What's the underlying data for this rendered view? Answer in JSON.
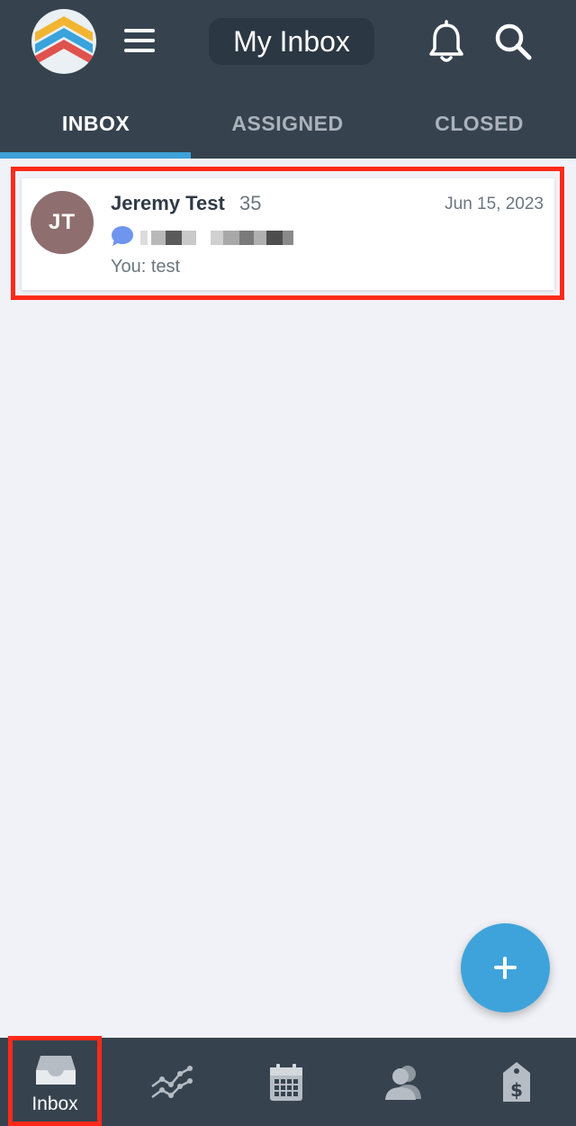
{
  "header": {
    "title": "My Inbox",
    "logo_icon": "striped-chevron-logo",
    "menu_icon": "hamburger-menu-icon",
    "bell_icon": "bell-icon",
    "search_icon": "search-icon"
  },
  "tabs": [
    {
      "label": "INBOX",
      "active": true
    },
    {
      "label": "ASSIGNED",
      "active": false
    },
    {
      "label": "CLOSED",
      "active": false
    }
  ],
  "conversations": [
    {
      "avatar_initials": "JT",
      "name": "Jeremy Test",
      "count": "35",
      "date": "Jun 15, 2023",
      "channel_icon": "chat-bubble-icon",
      "preview": "You: test"
    }
  ],
  "fab": {
    "icon": "plus-icon"
  },
  "bottom_nav": [
    {
      "label": "Inbox",
      "icon": "inbox-tray-icon",
      "active": true
    },
    {
      "label": "",
      "icon": "analytics-line-icon"
    },
    {
      "label": "",
      "icon": "calendar-icon"
    },
    {
      "label": "",
      "icon": "contacts-icon"
    },
    {
      "label": "",
      "icon": "price-tag-dollar-icon"
    }
  ],
  "colors": {
    "header_bg": "#36434f",
    "accent": "#3ea2d9",
    "page_bg": "#f0f2f7",
    "highlight": "#ff2a1a",
    "avatar_bg": "#8e6e6e"
  }
}
